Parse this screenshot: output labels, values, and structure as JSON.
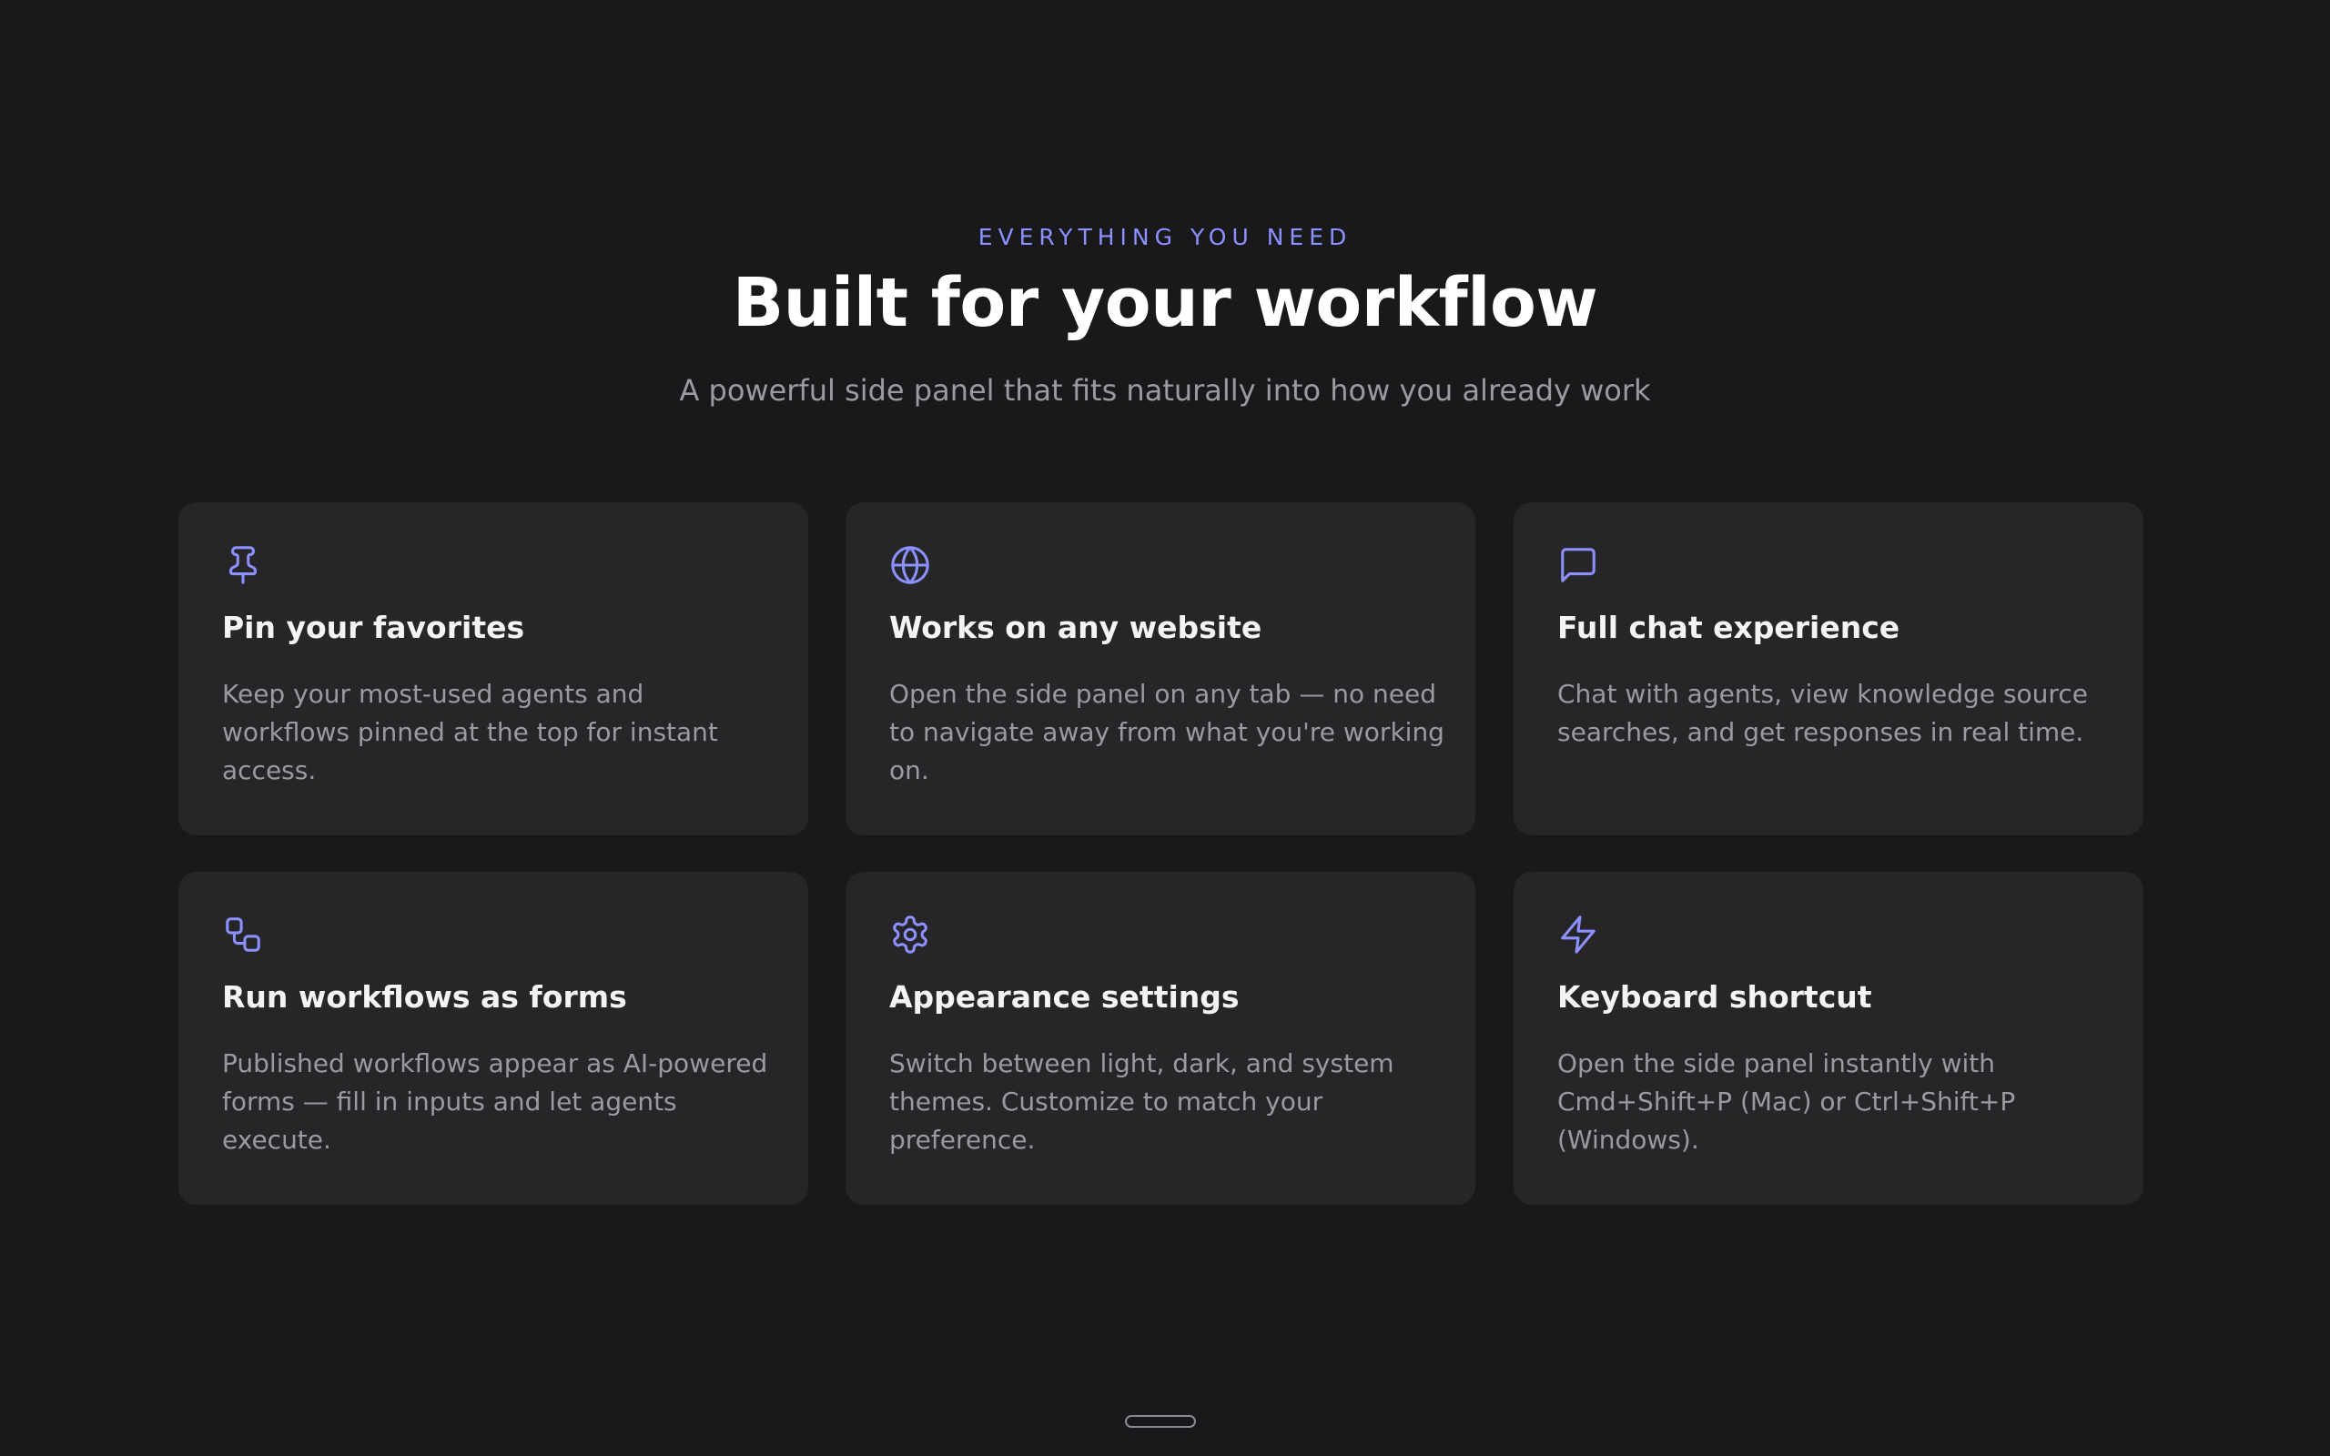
{
  "header": {
    "eyebrow": "EVERYTHING YOU NEED",
    "title": "Built for your workflow",
    "subtitle": "A powerful side panel that fits naturally into how you already work"
  },
  "features": [
    {
      "icon": "pin-icon",
      "title": "Pin your favorites",
      "description": "Keep your most-used agents and workflows pinned at the top for instant access."
    },
    {
      "icon": "globe-icon",
      "title": "Works on any website",
      "description": "Open the side panel on any tab — no need to navigate away from what you're working on."
    },
    {
      "icon": "chat-bubble-icon",
      "title": "Full chat experience",
      "description": "Chat with agents, view knowledge source searches, and get responses in real time."
    },
    {
      "icon": "workflow-icon",
      "title": "Run workflows as forms",
      "description": "Published workflows appear as AI-powered forms — fill in inputs and let agents execute."
    },
    {
      "icon": "gear-icon",
      "title": "Appearance settings",
      "description": "Switch between light, dark, and system themes. Customize to match your preference."
    },
    {
      "icon": "lightning-bolt-icon",
      "title": "Keyboard shortcut",
      "description": "Open the side panel instantly with Cmd+Shift+P (Mac) or Ctrl+Shift+P (Windows)."
    }
  ],
  "colors": {
    "background": "#19191b",
    "card": "#262628",
    "accent": "#8c91ff",
    "muted_text": "#9a9aa1"
  }
}
